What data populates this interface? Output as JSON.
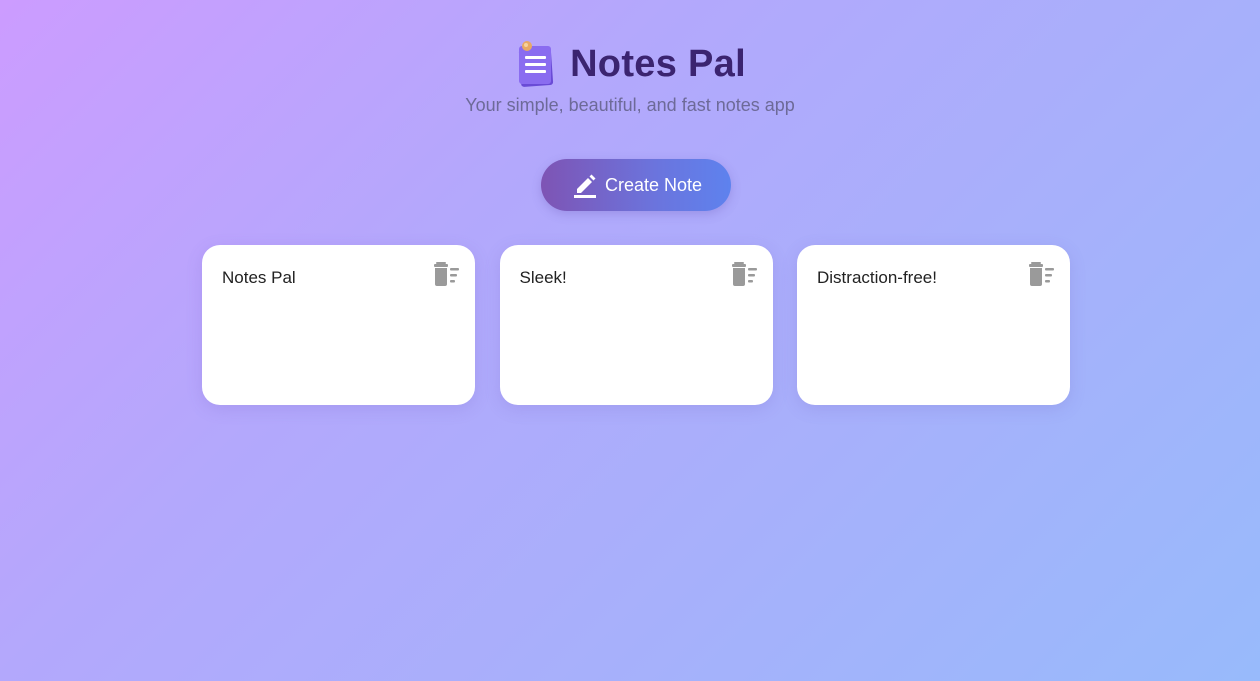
{
  "app": {
    "title": "Notes Pal",
    "subtitle": "Your simple, beautiful, and fast notes app",
    "logo_icon": "notepad-icon"
  },
  "toolbar": {
    "create_label": "Create Note",
    "create_icon": "pencil-icon"
  },
  "notes": [
    {
      "text": "Notes Pal",
      "delete_icon": "trash-icon"
    },
    {
      "text": "Sleek!",
      "delete_icon": "trash-icon"
    },
    {
      "text": "Distraction-free!",
      "delete_icon": "trash-icon"
    }
  ],
  "colors": {
    "title": "#3b2470",
    "subtitle": "#6d6a98",
    "button_start": "#7e54b4",
    "button_end": "#5e82ee",
    "card": "#ffffff",
    "delete_icon": "#9a9a9a"
  }
}
